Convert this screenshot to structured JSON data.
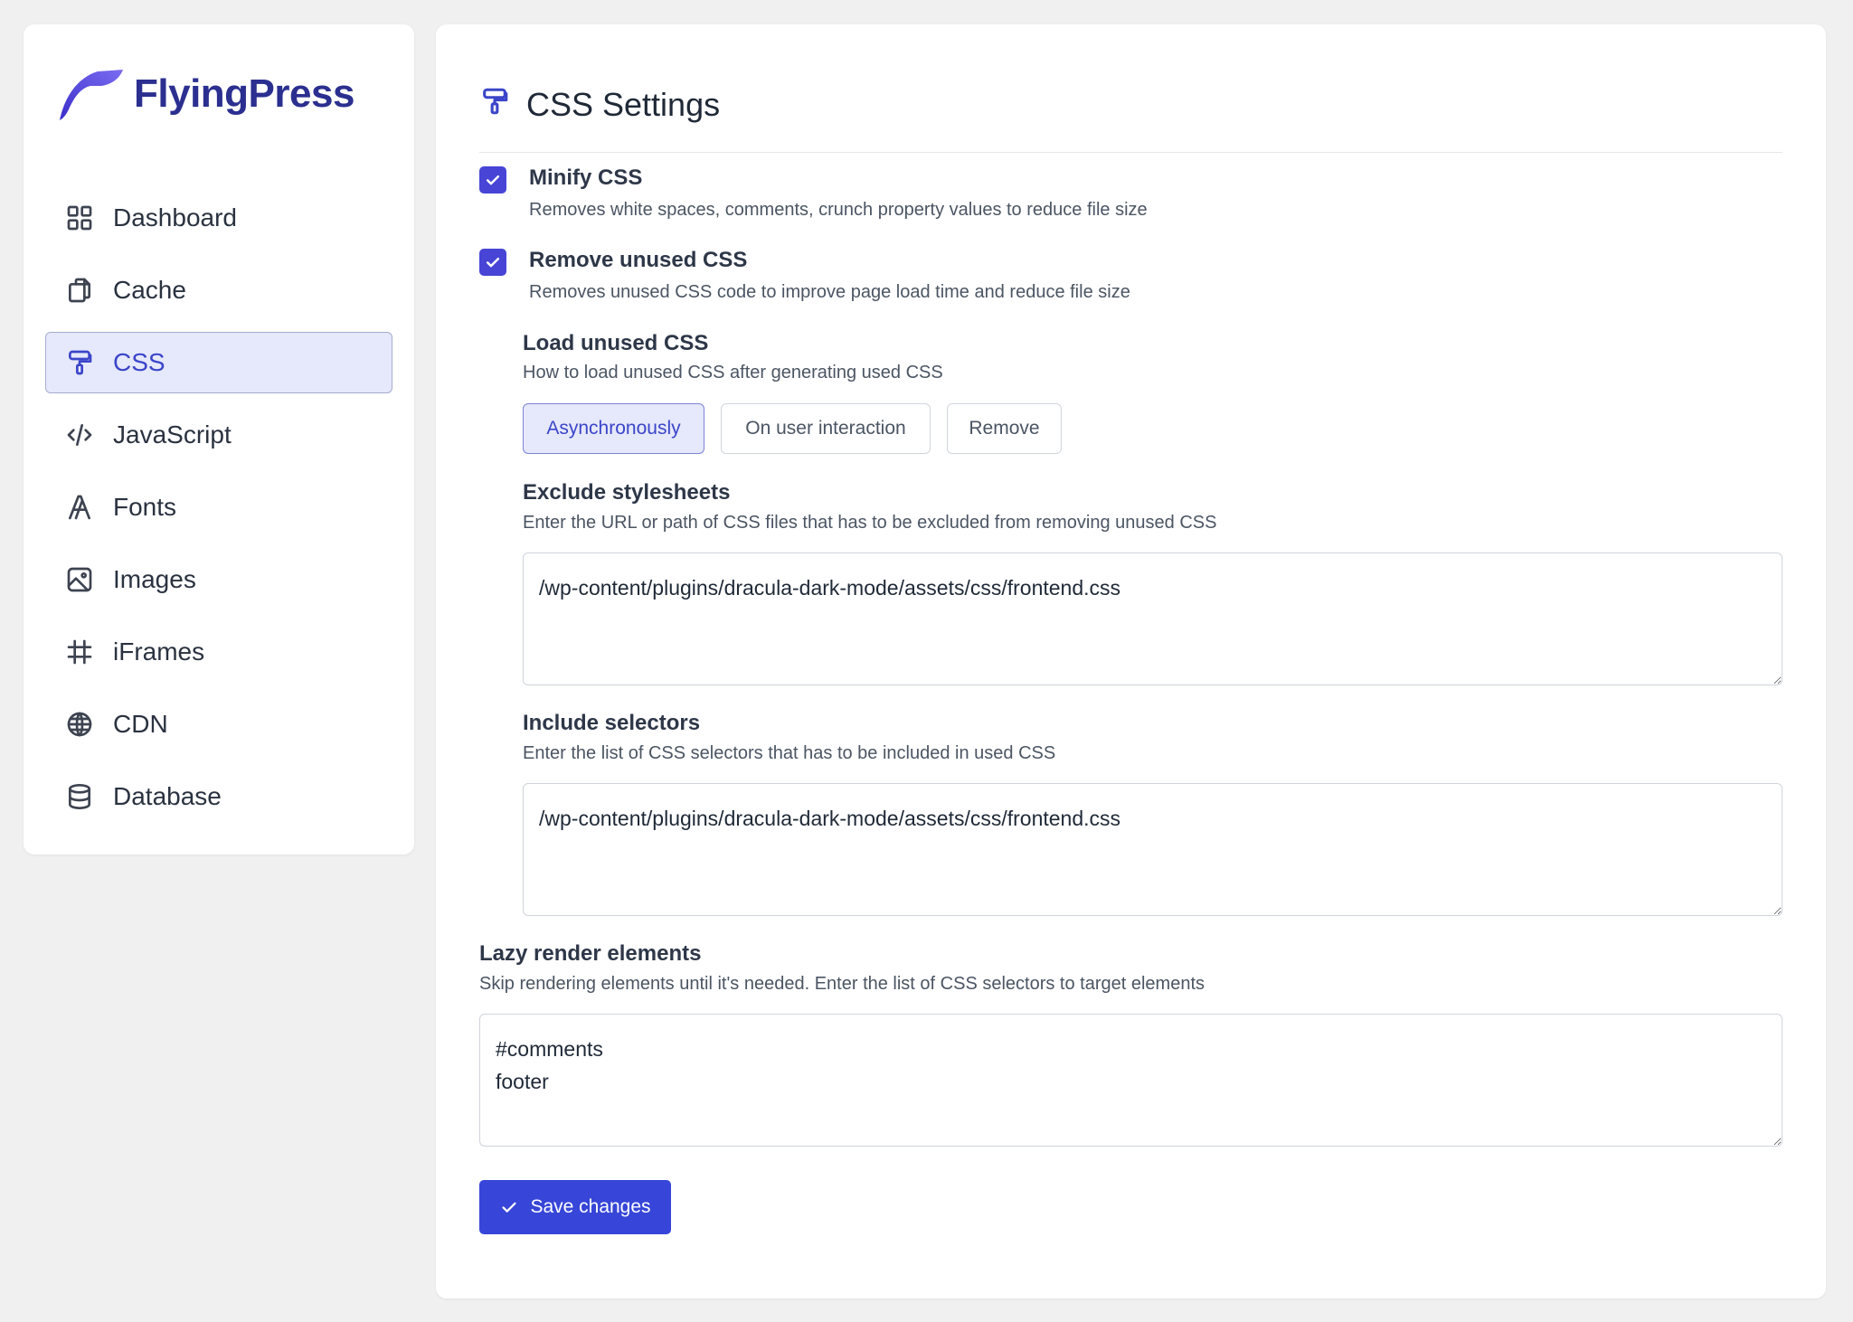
{
  "brand": {
    "name": "FlyingPress",
    "logo_icon": "wing-logo-icon",
    "accent": "#2b2f8f"
  },
  "sidebar": {
    "items": [
      {
        "label": "Dashboard",
        "icon": "grid-icon"
      },
      {
        "label": "Cache",
        "icon": "copy-icon"
      },
      {
        "label": "CSS",
        "icon": "paint-roller-icon",
        "active": true
      },
      {
        "label": "JavaScript",
        "icon": "code-icon"
      },
      {
        "label": "Fonts",
        "icon": "font-icon"
      },
      {
        "label": "Images",
        "icon": "image-icon"
      },
      {
        "label": "iFrames",
        "icon": "frame-icon"
      },
      {
        "label": "CDN",
        "icon": "globe-icon"
      },
      {
        "label": "Database",
        "icon": "database-icon"
      }
    ]
  },
  "page": {
    "title": "CSS Settings",
    "icon": "paint-roller-icon"
  },
  "settings": {
    "minify": {
      "title": "Minify CSS",
      "desc": "Removes white spaces, comments, crunch property values to reduce file size",
      "checked": true
    },
    "remove_unused": {
      "title": "Remove unused CSS",
      "desc": "Removes unused CSS code to improve page load time and reduce file size",
      "checked": true
    },
    "load_unused": {
      "title": "Load unused CSS",
      "desc": "How to load unused CSS after generating used CSS",
      "options": [
        "Asynchronously",
        "On user interaction",
        "Remove"
      ],
      "selected": "Asynchronously"
    },
    "exclude": {
      "title": "Exclude stylesheets",
      "desc": "Enter the URL or path of CSS files that has to be excluded from removing unused CSS",
      "value": "/wp-content/plugins/dracula-dark-mode/assets/css/frontend.css"
    },
    "include": {
      "title": "Include selectors",
      "desc": "Enter the list of CSS selectors that has to be included in used CSS",
      "value": "/wp-content/plugins/dracula-dark-mode/assets/css/frontend.css"
    },
    "lazy": {
      "title": "Lazy render elements",
      "desc": "Skip rendering elements until it's needed. Enter the list of CSS selectors to target elements",
      "value": "#comments\nfooter"
    }
  },
  "actions": {
    "save_label": "Save changes",
    "save_icon": "check-icon"
  },
  "colors": {
    "primary": "#3746d8",
    "active_bg": "#e6e8fb",
    "page_bg": "#f0f0f1"
  }
}
